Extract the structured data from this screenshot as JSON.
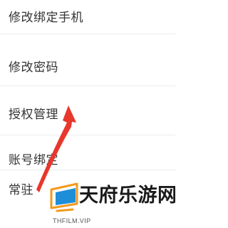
{
  "settings": {
    "items": [
      {
        "label": "修改绑定手机"
      },
      {
        "label": "修改密码"
      },
      {
        "label": "授权管理"
      },
      {
        "label": "账号绑定"
      },
      {
        "label": "常驻"
      }
    ]
  },
  "watermark": {
    "title": "天府乐游网",
    "subtitle": "THFILM.VIP"
  },
  "colors": {
    "arrow": "#e8372c",
    "text": "#333333",
    "divider": "#ececec",
    "logo_orange": "#f39a1e",
    "logo_blue": "#1f8ed8"
  },
  "icons": {
    "annotation": "red-arrow-up",
    "watermark_logo": "monitor-logo-icon"
  }
}
